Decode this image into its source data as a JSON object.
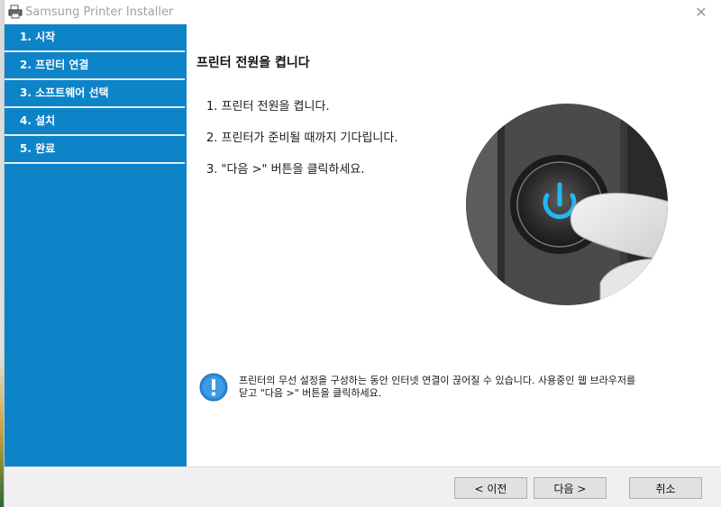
{
  "window": {
    "title": "Samsung Printer Installer",
    "close_glyph": "✕"
  },
  "sidebar": {
    "steps": [
      {
        "label": "1. 시작"
      },
      {
        "label": "2. 프린터 연결"
      },
      {
        "label": "3. 소프트웨어 선택"
      },
      {
        "label": "4. 설치"
      },
      {
        "label": "5. 완료"
      }
    ],
    "active_index": 1
  },
  "main": {
    "heading": "프린터 전원을 켭니다",
    "instructions": [
      "1. 프린터 전원을 켭니다.",
      "2. 프린터가 준비될 때까지 기다립니다.",
      "3. \"다음 >\" 버튼을 클릭하세요."
    ],
    "notice": {
      "icon": "info-icon",
      "line1": "프린터의 무선 설정을 구성하는 동안 인터넷 연결이 끊어질 수 있습니다. 사용중인 웹 브라우저를",
      "line2": "닫고 \"다음 >\" 버튼을 클릭하세요."
    }
  },
  "footer": {
    "prev_label": "< 이전",
    "next_label": "다음 >",
    "cancel_label": "취소"
  },
  "colors": {
    "sidebar": "#0d84c8",
    "power_glow": "#25b6ef"
  }
}
